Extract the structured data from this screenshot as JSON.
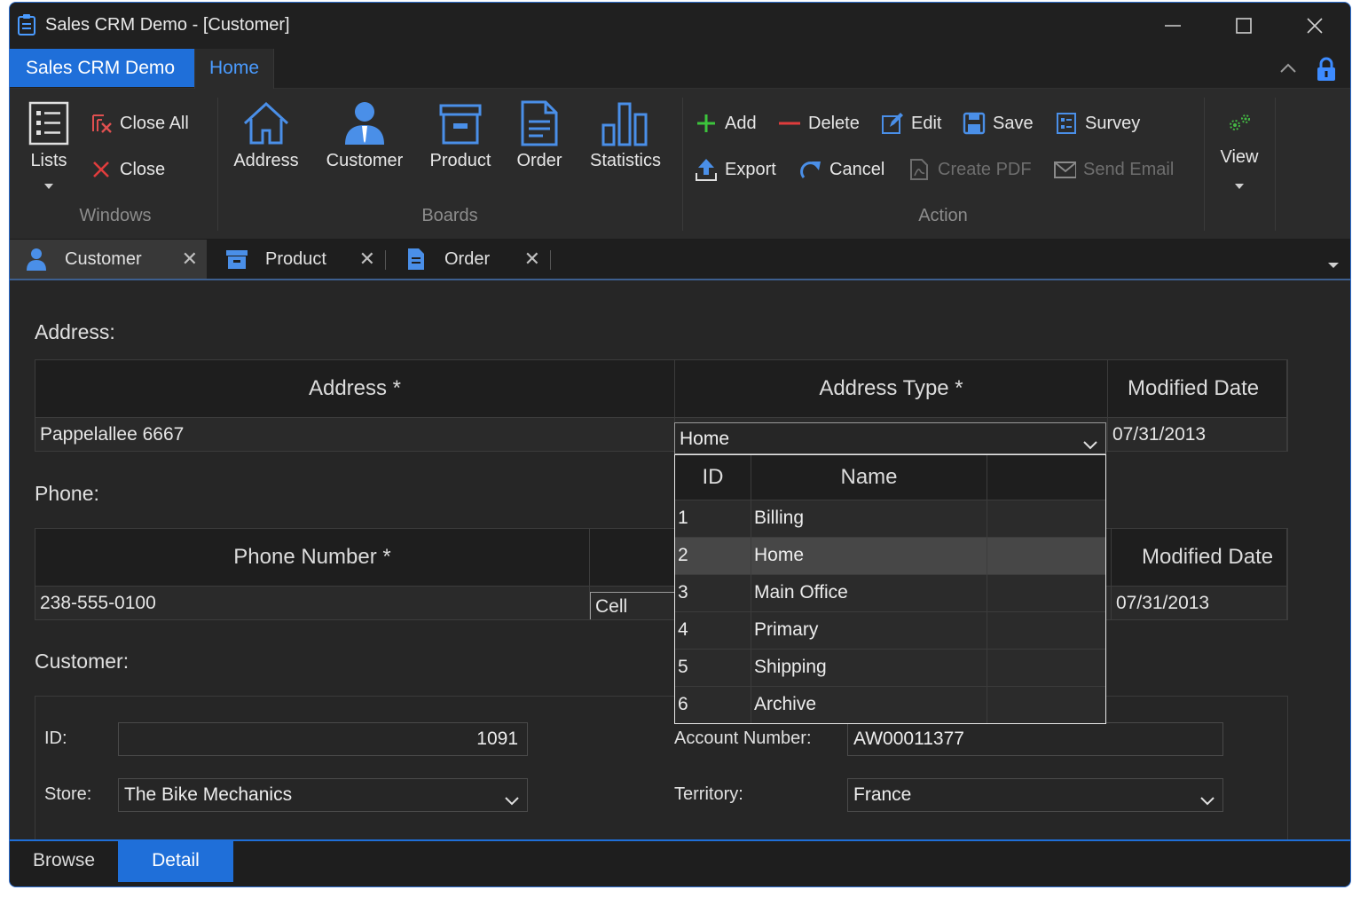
{
  "window": {
    "title": "Sales CRM Demo - [Customer]"
  },
  "ribbon_tabs": {
    "app_tab": "Sales CRM Demo",
    "home_tab": "Home"
  },
  "ribbon": {
    "windows": {
      "label": "Windows",
      "lists": "Lists",
      "close_all": "Close All",
      "close": "Close"
    },
    "boards": {
      "label": "Boards",
      "address": "Address",
      "customer": "Customer",
      "product": "Product",
      "order": "Order",
      "statistics": "Statistics"
    },
    "action": {
      "label": "Action",
      "add": "Add",
      "delete": "Delete",
      "edit": "Edit",
      "save": "Save",
      "survey": "Survey",
      "export": "Export",
      "cancel": "Cancel",
      "create_pdf": "Create PDF",
      "send_email": "Send Email"
    },
    "view": {
      "label": "View"
    }
  },
  "doc_tabs": [
    {
      "label": "Customer",
      "active": true
    },
    {
      "label": "Product",
      "active": false
    },
    {
      "label": "Order",
      "active": false
    }
  ],
  "address_section": {
    "title": "Address:",
    "columns": [
      "Address *",
      "Address Type *",
      "Modified Date"
    ],
    "row": {
      "address": "Pappelallee 6667",
      "address_type": "Home",
      "modified_date": "07/31/2013"
    }
  },
  "address_type_popup": {
    "columns": [
      "ID",
      "Name"
    ],
    "rows": [
      {
        "id": "1",
        "name": "Billing"
      },
      {
        "id": "2",
        "name": "Home"
      },
      {
        "id": "3",
        "name": "Main Office"
      },
      {
        "id": "4",
        "name": "Primary"
      },
      {
        "id": "5",
        "name": "Shipping"
      },
      {
        "id": "6",
        "name": "Archive"
      }
    ],
    "selected_id": "2"
  },
  "phone_section": {
    "title": "Phone:",
    "columns": [
      "Phone Number *",
      "",
      "Modified Date"
    ],
    "row": {
      "phone_number": "238-555-0100",
      "phone_type": "Cell",
      "modified_date": "07/31/2013"
    }
  },
  "customer_section": {
    "title": "Customer:",
    "id_label": "ID:",
    "id_value": "1091",
    "store_label": "Store:",
    "store_value": "The Bike Mechanics",
    "account_label": "Account Number:",
    "account_value": "AW00011377",
    "territory_label": "Territory:",
    "territory_value": "France"
  },
  "bottom_tabs": {
    "browse": "Browse",
    "detail": "Detail",
    "active": "detail"
  },
  "colors": {
    "accent": "#1f6fd9",
    "background": "#262626",
    "header": "#1e1e1e"
  }
}
